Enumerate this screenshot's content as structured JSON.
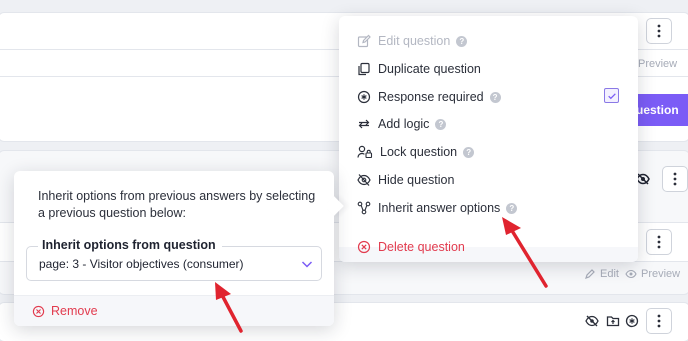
{
  "background": {
    "preview_label": "Preview",
    "edit_label": "Edit",
    "primary_button_label": "uestion"
  },
  "menu": {
    "items": [
      {
        "label": "Edit question",
        "icon": "edit-icon",
        "help": "?"
      },
      {
        "label": "Duplicate question",
        "icon": "duplicate-icon",
        "help": ""
      },
      {
        "label": "Response required",
        "icon": "required-icon",
        "help": "?"
      },
      {
        "label": "Add logic",
        "icon": "logic-icon",
        "help": "?"
      },
      {
        "label": "Lock question",
        "icon": "lock-user-icon",
        "help": "?"
      },
      {
        "label": "Hide question",
        "icon": "hide-icon",
        "help": ""
      },
      {
        "label": "Inherit answer options",
        "icon": "inherit-icon",
        "help": "?"
      }
    ],
    "delete_label": "Delete question"
  },
  "popover": {
    "description": "Inherit options from previous answers by selecting a previous question below:",
    "field_label": "Inherit options from question",
    "selected_value": "page: 3 - Visitor objectives (consumer)",
    "remove_label": "Remove"
  },
  "colors": {
    "accent": "#7b5cf6",
    "danger": "#e23b4e",
    "annotation_arrow": "#e0242f"
  }
}
